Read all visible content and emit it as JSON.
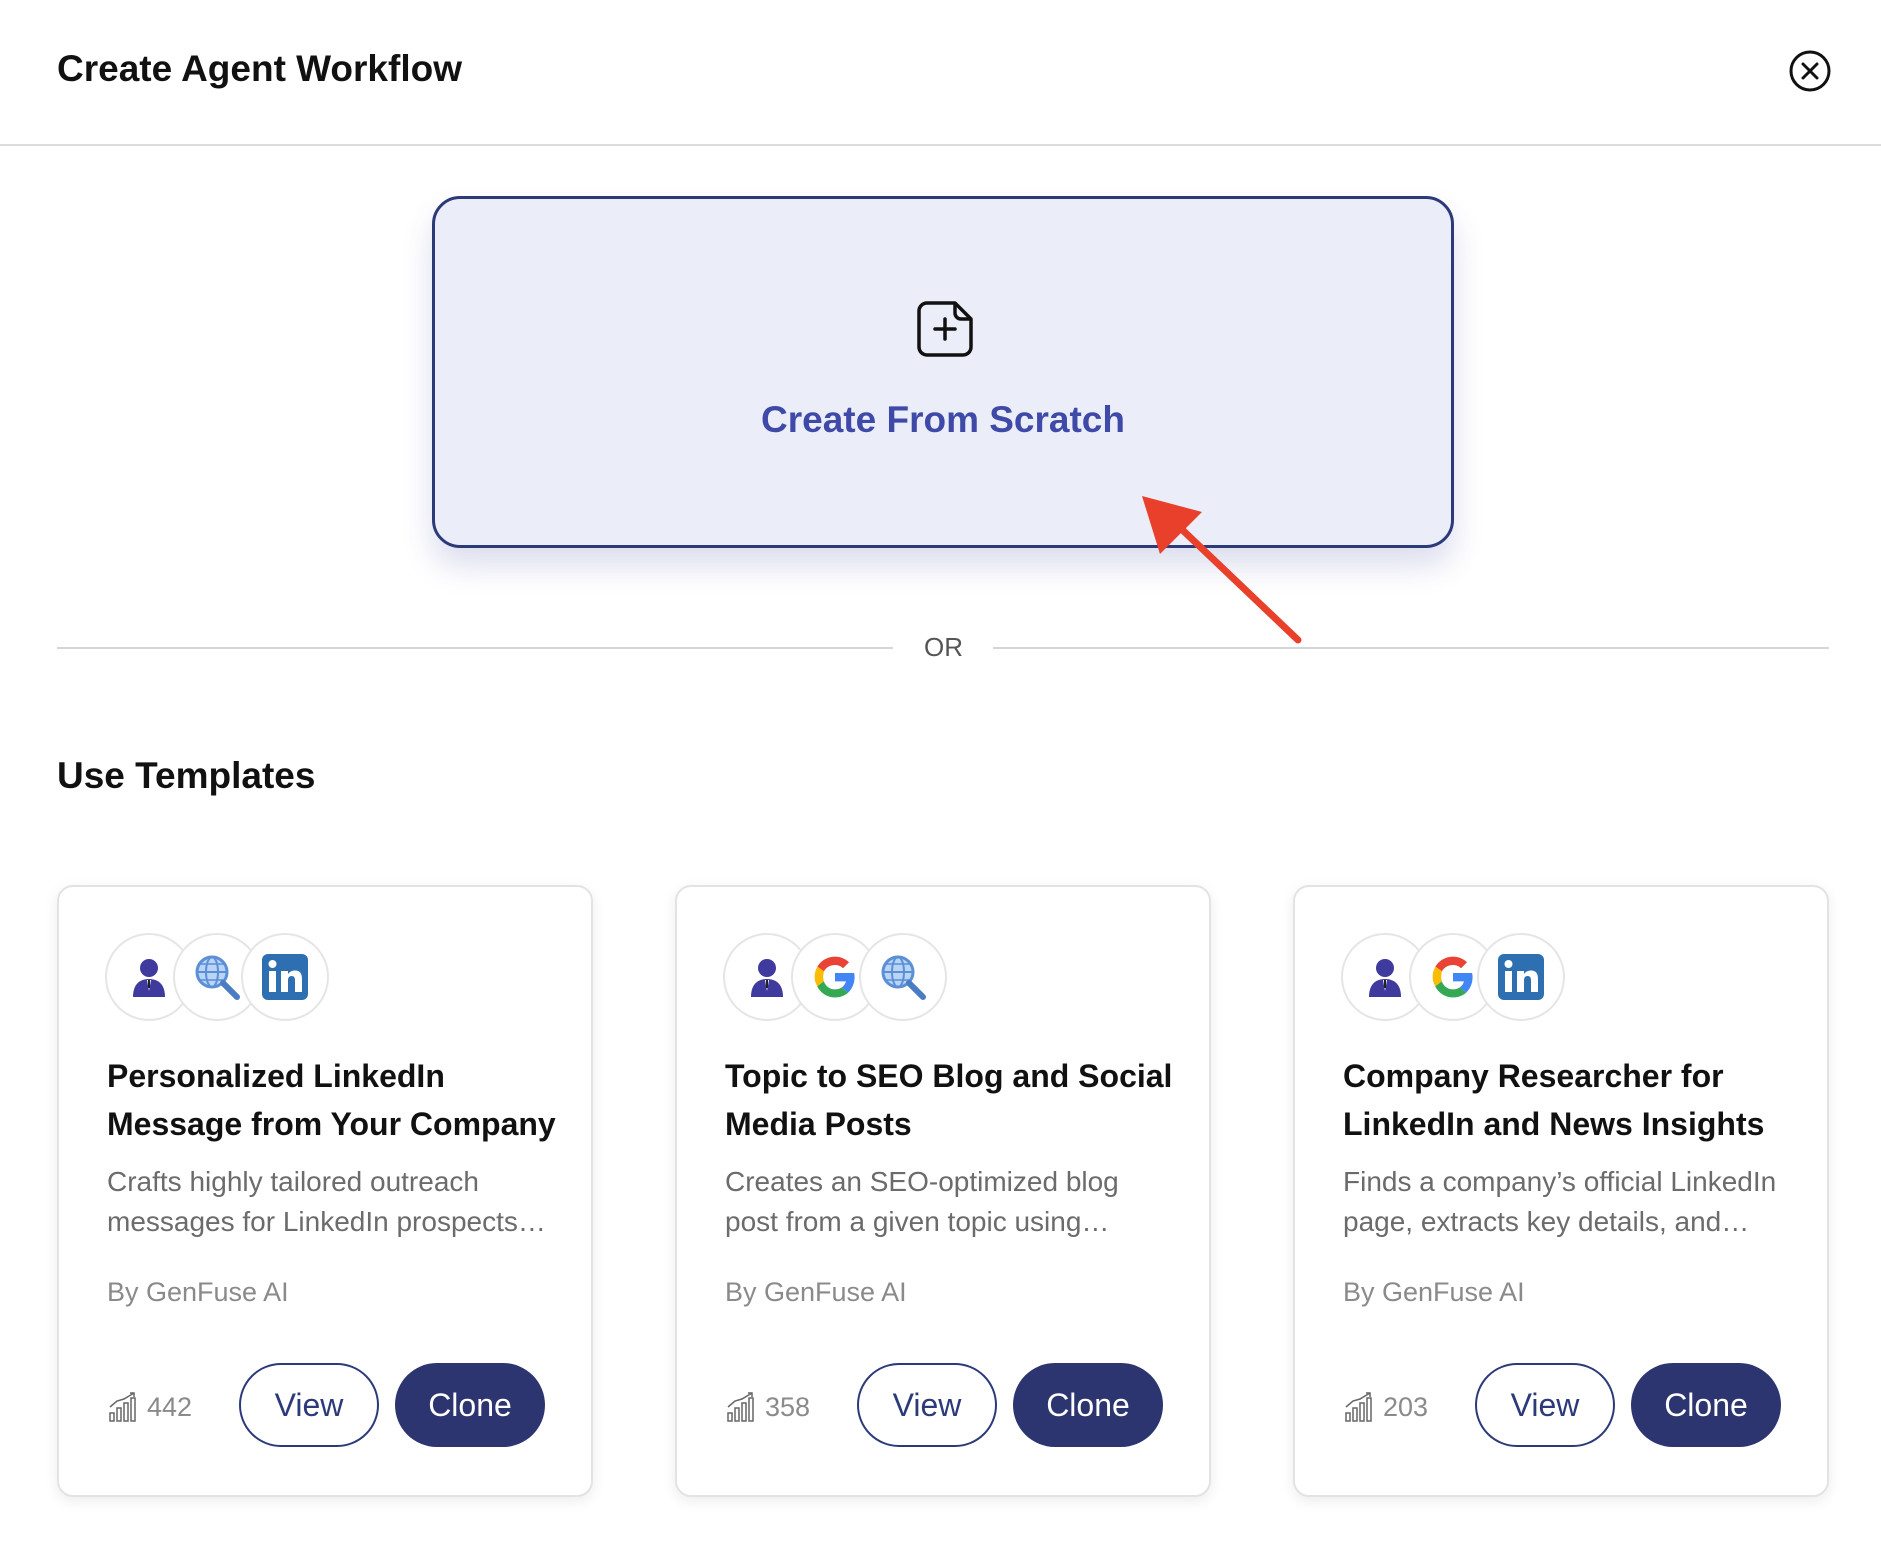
{
  "header": {
    "title": "Create Agent Workflow",
    "close_icon": "close-circle-icon"
  },
  "scratch": {
    "label": "Create From Scratch",
    "icon": "new-document-plus-icon"
  },
  "divider": {
    "label": "OR"
  },
  "templates": {
    "section_title": "Use Templates",
    "cards": [
      {
        "title": "Personalized LinkedIn Message from Your Company",
        "description": "Crafts highly tailored outreach messages for LinkedIn prospects…",
        "author": "By GenFuse AI",
        "count": "442",
        "view_label": "View",
        "clone_label": "Clone",
        "icons": [
          "agent-icon",
          "web-search-icon",
          "linkedin-icon"
        ]
      },
      {
        "title": "Topic to SEO Blog and Social Media Posts",
        "description": "Creates an SEO-optimized blog post from a given topic using…",
        "author": "By GenFuse AI",
        "count": "358",
        "view_label": "View",
        "clone_label": "Clone",
        "icons": [
          "agent-icon",
          "google-icon",
          "web-search-icon"
        ]
      },
      {
        "title": "Company Researcher for LinkedIn and News Insights",
        "description": "Finds a company’s official LinkedIn page, extracts key details, and…",
        "author": "By GenFuse AI",
        "count": "203",
        "view_label": "View",
        "clone_label": "Clone",
        "icons": [
          "agent-icon",
          "google-icon",
          "linkedin-icon"
        ]
      }
    ]
  },
  "colors": {
    "primary": "#2c3570",
    "accent_text": "#3f4aa8",
    "scratch_bg": "#ebeef8",
    "annotation_arrow": "#e8402a"
  }
}
